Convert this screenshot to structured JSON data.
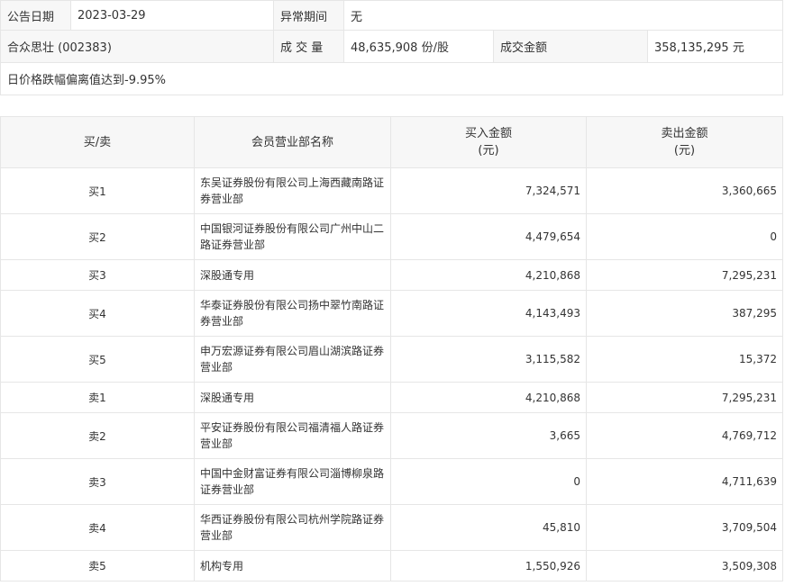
{
  "header": {
    "announce_date_label": "公告日期",
    "announce_date_value": "2023-03-29",
    "abnormal_period_label": "异常期间",
    "abnormal_period_value": "无",
    "stock_name": "合众思壮 (002383)",
    "volume_label": "成 交 量",
    "volume_value": "48,635,908 份/股",
    "amount_label": "成交金额",
    "amount_value": "358,135,295 元",
    "description": "日价格跌幅偏离值达到-9.95%"
  },
  "table": {
    "col_side": "买/卖",
    "col_branch": "会员营业部名称",
    "col_buy_line1": "买入金额",
    "col_buy_line2": "(元)",
    "col_sell_line1": "卖出金额",
    "col_sell_line2": "(元)",
    "rows": [
      {
        "side": "买1",
        "branch": "东吴证券股份有限公司上海西藏南路证券营业部",
        "buy": "7,324,571",
        "sell": "3,360,665"
      },
      {
        "side": "买2",
        "branch": "中国银河证券股份有限公司广州中山二路证券营业部",
        "buy": "4,479,654",
        "sell": "0"
      },
      {
        "side": "买3",
        "branch": "深股通专用",
        "buy": "4,210,868",
        "sell": "7,295,231"
      },
      {
        "side": "买4",
        "branch": "华泰证券股份有限公司扬中翠竹南路证券营业部",
        "buy": "4,143,493",
        "sell": "387,295"
      },
      {
        "side": "买5",
        "branch": "申万宏源证券有限公司眉山湖滨路证券营业部",
        "buy": "3,115,582",
        "sell": "15,372"
      },
      {
        "side": "卖1",
        "branch": "深股通专用",
        "buy": "4,210,868",
        "sell": "7,295,231"
      },
      {
        "side": "卖2",
        "branch": "平安证券股份有限公司福清福人路证券营业部",
        "buy": "3,665",
        "sell": "4,769,712"
      },
      {
        "side": "卖3",
        "branch": "中国中金财富证券有限公司淄博柳泉路证券营业部",
        "buy": "0",
        "sell": "4,711,639"
      },
      {
        "side": "卖4",
        "branch": "华西证券股份有限公司杭州学院路证券营业部",
        "buy": "45,810",
        "sell": "3,709,504"
      },
      {
        "side": "卖5",
        "branch": "机构专用",
        "buy": "1,550,926",
        "sell": "3,509,308"
      }
    ]
  }
}
